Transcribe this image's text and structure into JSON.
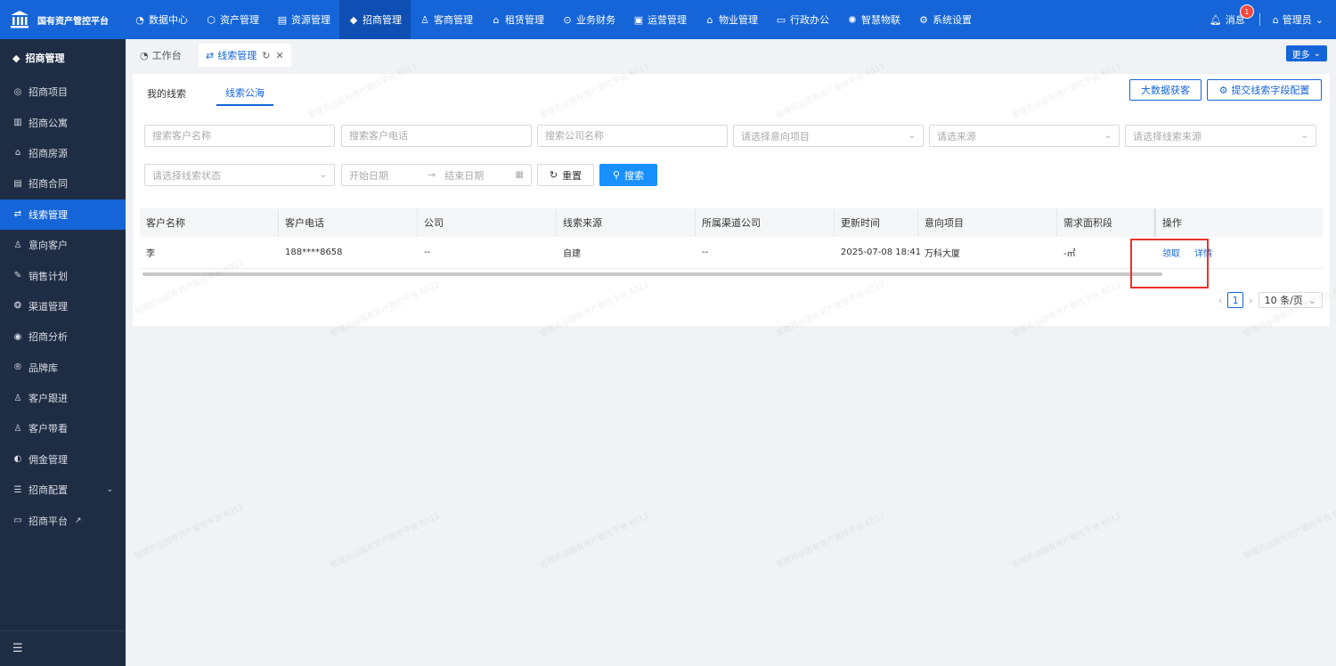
{
  "app": {
    "title": "国有资产管控平台"
  },
  "nav": [
    {
      "label": "数据中心",
      "icon": "dashboard-icon"
    },
    {
      "label": "资产管理",
      "icon": "cube-icon"
    },
    {
      "label": "资源管理",
      "icon": "building-icon"
    },
    {
      "label": "招商管理",
      "icon": "tag-icon",
      "active": true
    },
    {
      "label": "客商管理",
      "icon": "users-icon"
    },
    {
      "label": "租赁管理",
      "icon": "home-icon"
    },
    {
      "label": "业务财务",
      "icon": "coin-icon"
    },
    {
      "label": "运营管理",
      "icon": "chart-icon"
    },
    {
      "label": "物业管理",
      "icon": "house-icon"
    },
    {
      "label": "行政办公",
      "icon": "monitor-icon"
    },
    {
      "label": "智慧物联",
      "icon": "iot-icon"
    },
    {
      "label": "系统设置",
      "icon": "gear-icon"
    }
  ],
  "header": {
    "messages_label": "消息",
    "messages_count": "1",
    "user_label": "管理员"
  },
  "sidebar": {
    "title": "招商管理",
    "items": [
      {
        "label": "招商项目"
      },
      {
        "label": "招商公寓"
      },
      {
        "label": "招商房源"
      },
      {
        "label": "招商合同"
      },
      {
        "label": "线索管理",
        "active": true
      },
      {
        "label": "意向客户"
      },
      {
        "label": "销售计划"
      },
      {
        "label": "渠道管理"
      },
      {
        "label": "招商分析"
      },
      {
        "label": "品牌库"
      },
      {
        "label": "客户跟进"
      },
      {
        "label": "客户带看"
      },
      {
        "label": "佣金管理"
      },
      {
        "label": "招商配置"
      },
      {
        "label": "招商平台"
      }
    ]
  },
  "tabs": {
    "home": "工作台",
    "current": "线索管理",
    "more": "更多"
  },
  "subtabs": {
    "mine": "我的线索",
    "pool": "线索公海"
  },
  "actions": {
    "bigdata": "大数据获客",
    "field_config": "提交线索字段配置"
  },
  "filters": {
    "customer_name": "搜索客户名称",
    "customer_phone": "搜索客户电话",
    "company_name": "搜索公司名称",
    "project": "请选择意向项目",
    "source": "请选来源",
    "clue_source": "请选择线索来源",
    "status": "请选择线索状态",
    "start_date": "开始日期",
    "end_date": "结束日期",
    "reset": "重置",
    "search": "搜索"
  },
  "table": {
    "headers": [
      "客户名称",
      "客户电话",
      "公司",
      "线索来源",
      "所属渠道公司",
      "更新时间",
      "意向项目",
      "需求面积段",
      "操作"
    ],
    "rows": [
      {
        "name": "李",
        "phone": "188****8658",
        "company": "--",
        "source": "自建",
        "channel": "--",
        "updated": "2025-07-08 18:41",
        "project": "万科大厦",
        "area": "-㎡",
        "op_claim": "领取",
        "op_detail": "详情"
      }
    ]
  },
  "pager": {
    "current": "1",
    "size": "10 条/页"
  },
  "watermark": "管理员@国有资产管控平台 6013"
}
